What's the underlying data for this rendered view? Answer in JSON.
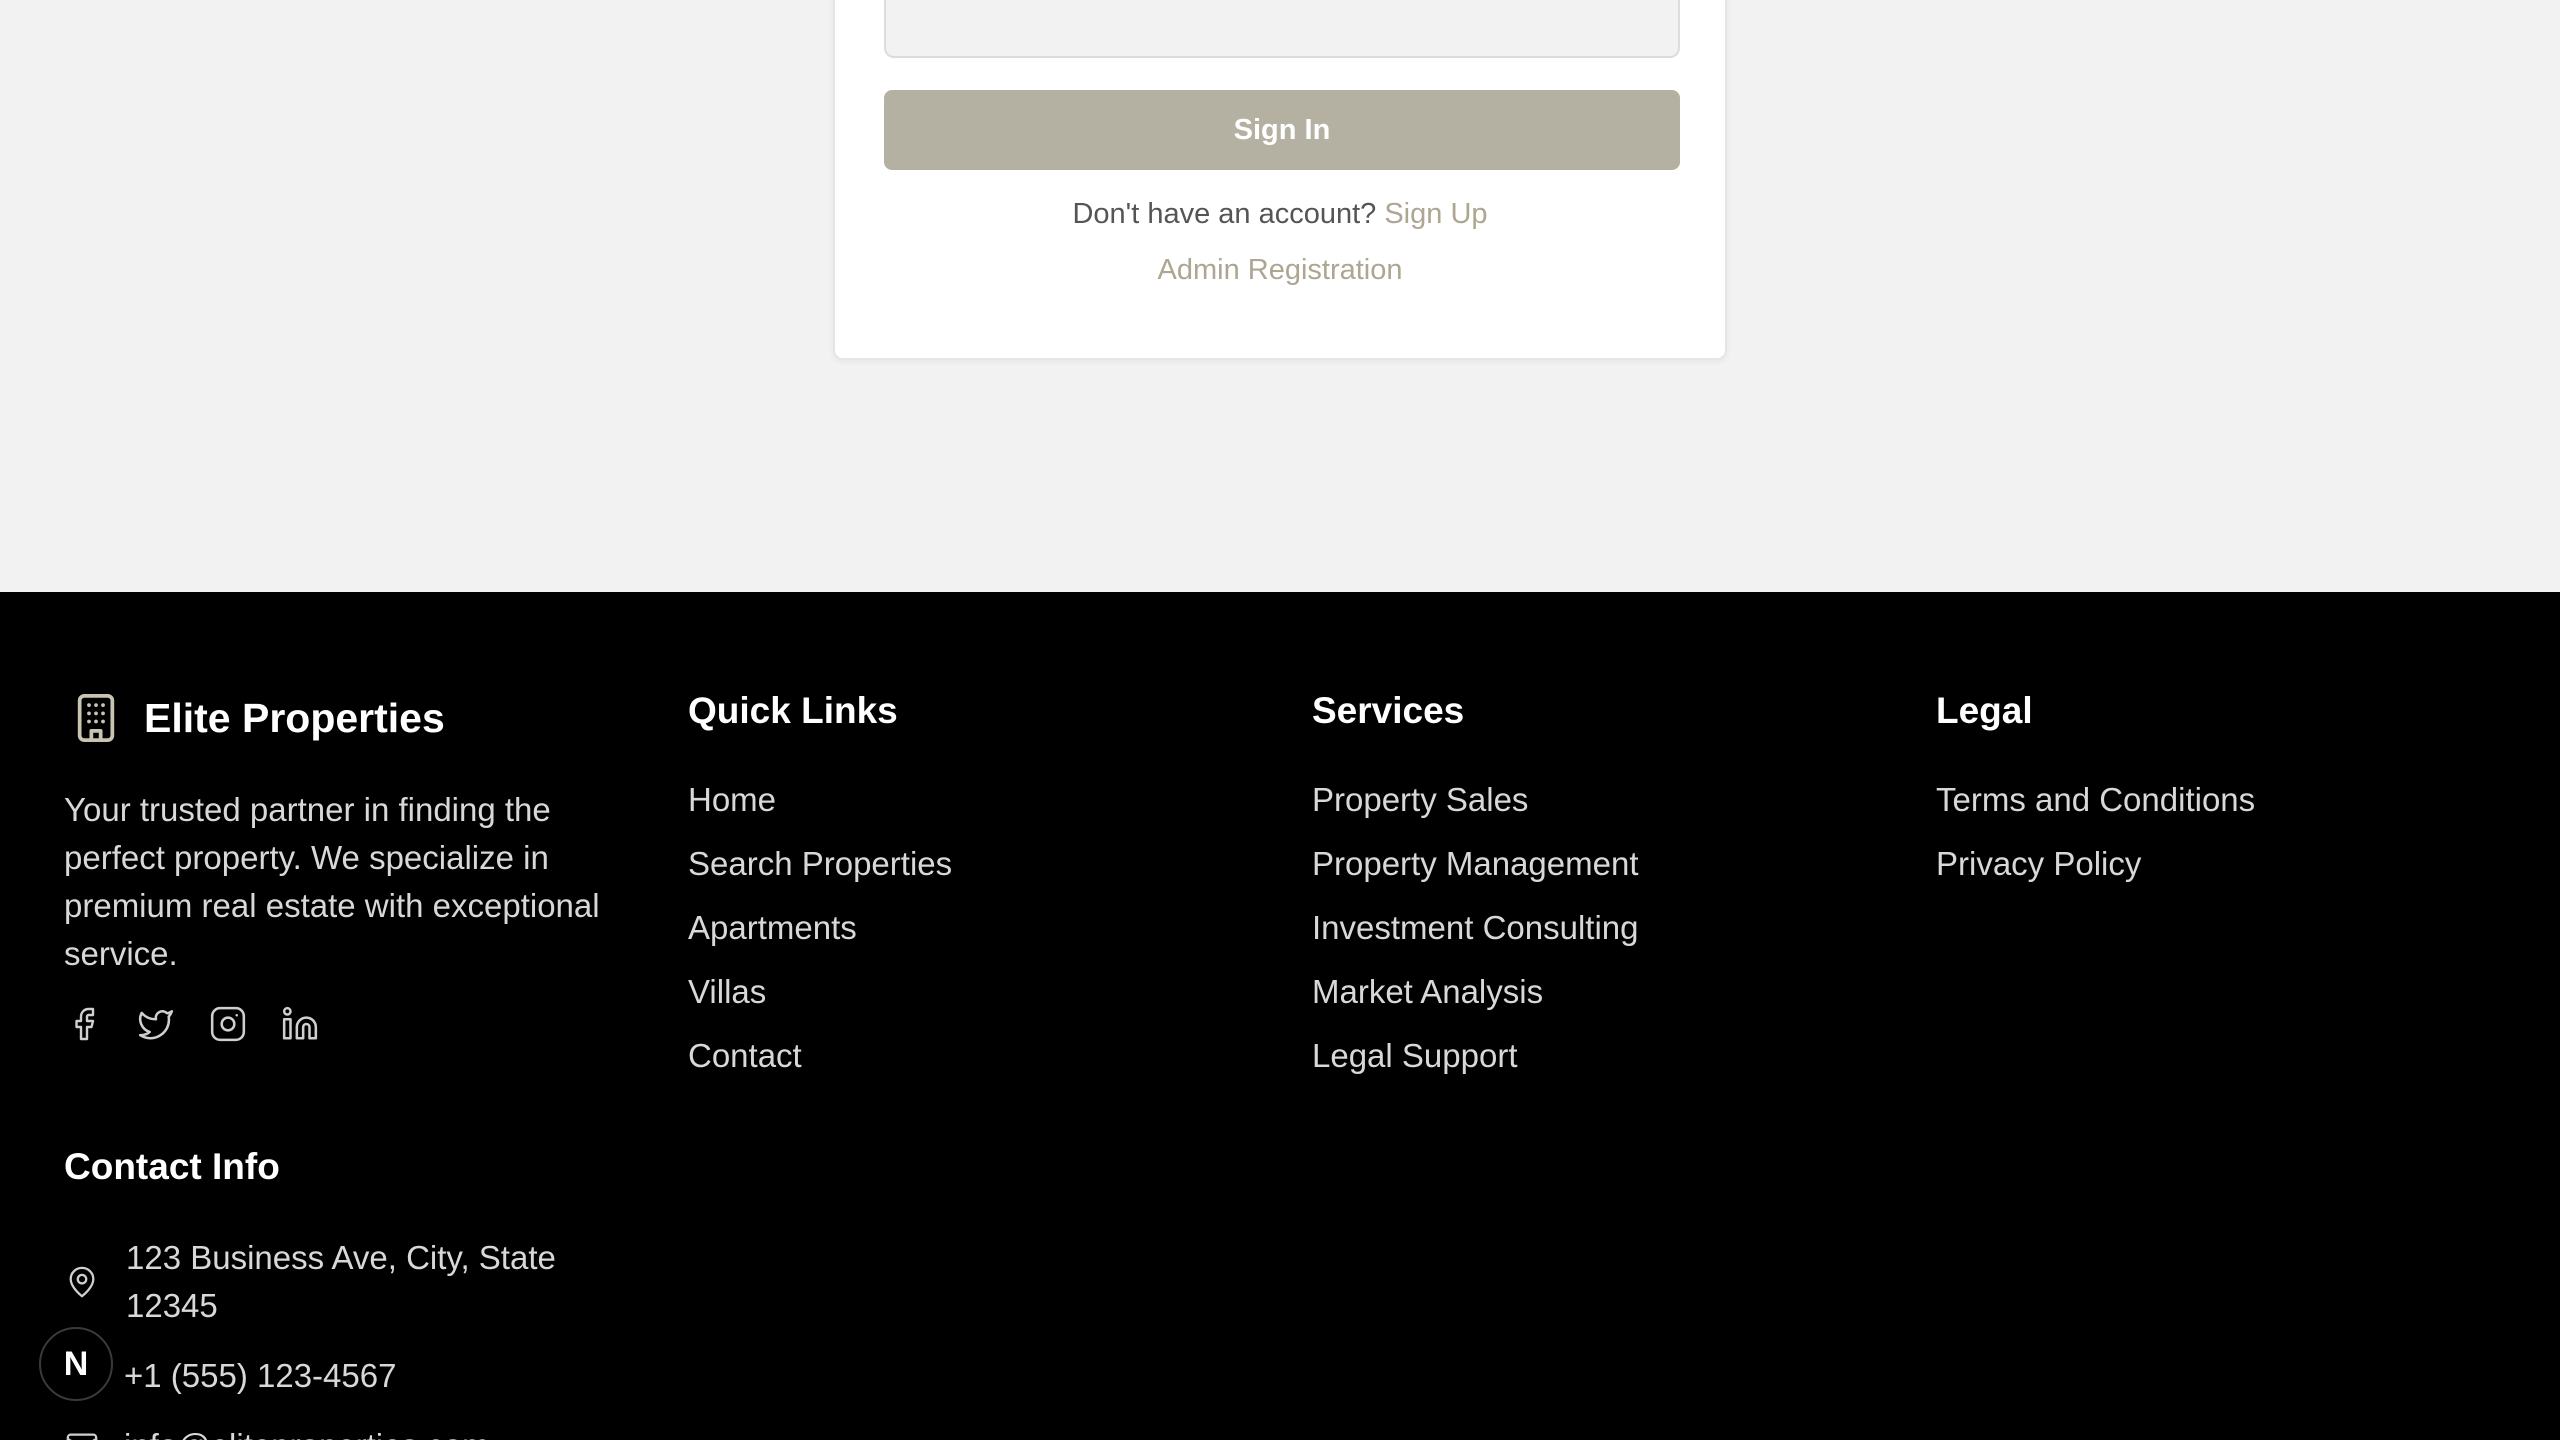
{
  "auth": {
    "signin_label": "Sign In",
    "no_account_text": "Don't have an account?",
    "signup_label": "Sign Up",
    "admin_label": "Admin Registration"
  },
  "footer": {
    "brand": {
      "name": "Elite Properties",
      "icon": "building-icon",
      "description": "Your trusted partner in finding the perfect property. We specialize in premium real estate with exceptional service."
    },
    "socials": [
      "facebook-icon",
      "twitter-icon",
      "instagram-icon",
      "linkedin-icon"
    ],
    "quick_links": {
      "title": "Quick Links",
      "items": [
        "Home",
        "Search Properties",
        "Apartments",
        "Villas",
        "Contact"
      ]
    },
    "services": {
      "title": "Services",
      "items": [
        "Property Sales",
        "Property Management",
        "Investment Consulting",
        "Market Analysis",
        "Legal Support"
      ]
    },
    "legal": {
      "title": "Legal",
      "items": [
        "Terms and Conditions",
        "Privacy Policy"
      ]
    },
    "contact": {
      "title": "Contact Info",
      "address_line1": "123 Business Ave, City, State",
      "address_line2": "12345",
      "phone": "+1 (555) 123-4567",
      "email": "info@eliteproperties.com"
    }
  },
  "badge": {
    "letter": "N"
  },
  "colors": {
    "accent": "#b5b1a2",
    "link": "#aca692",
    "footer_bg": "#000000",
    "page_bg": "#f2f2f2"
  }
}
